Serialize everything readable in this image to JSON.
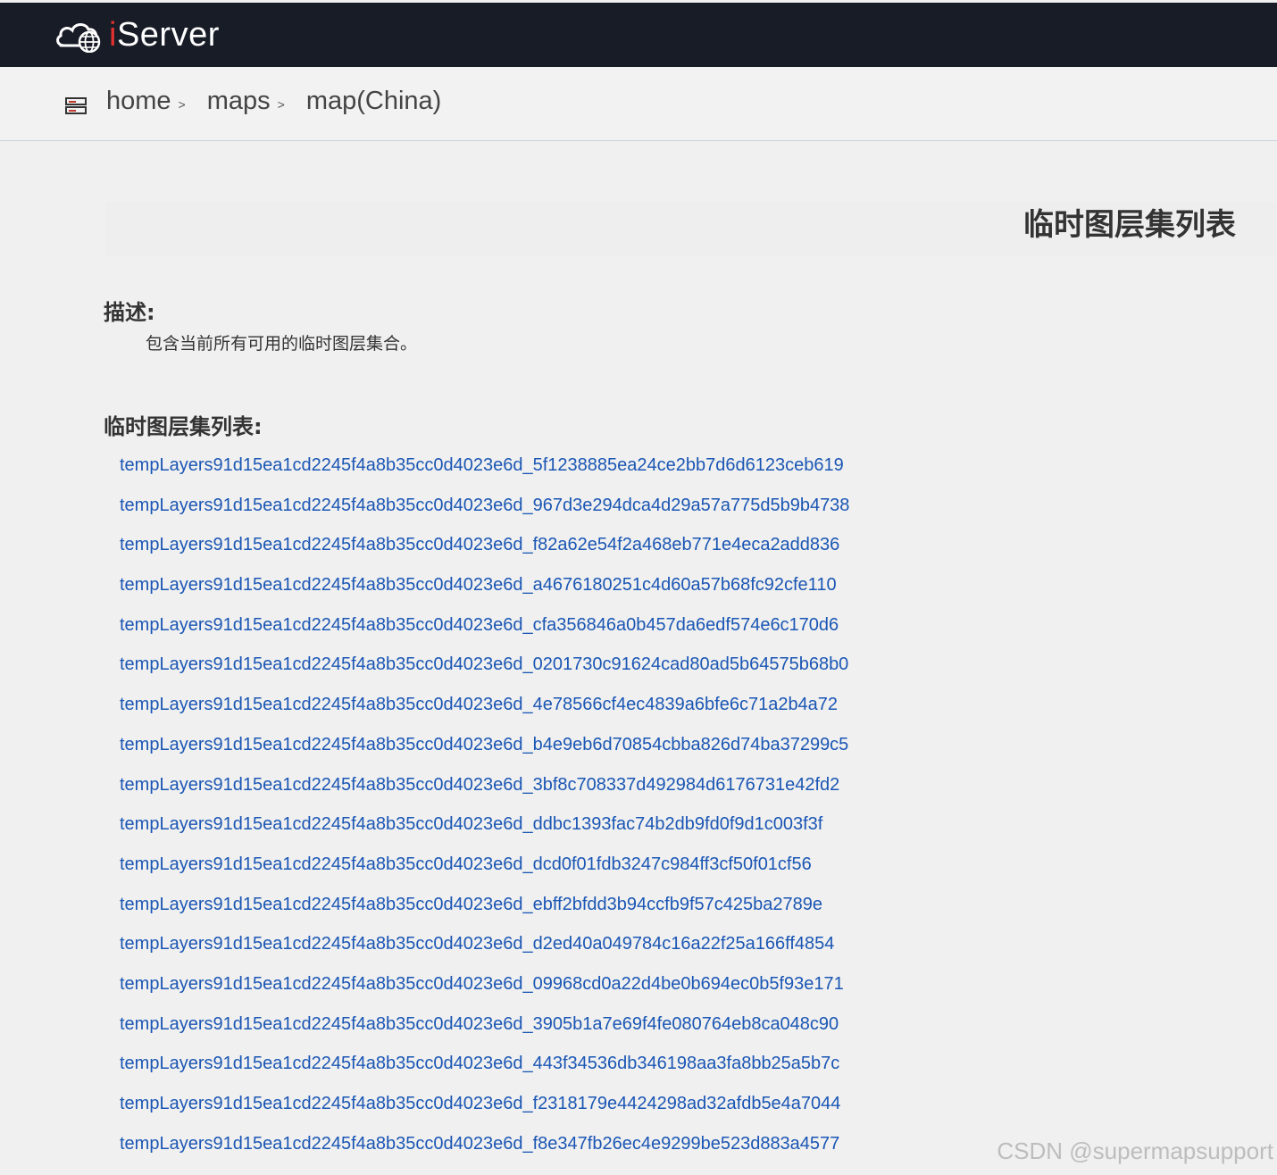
{
  "header": {
    "logo_text": "Server",
    "logo_i": "i",
    "logo_icon": "cloud-globe-icon",
    "accent": "#e0312f",
    "background": "#181c27"
  },
  "breadcrumb": {
    "icon": "server-stack-icon",
    "items": [
      {
        "label": "home",
        "sep": ">"
      },
      {
        "label": "maps",
        "sep": ">"
      },
      {
        "label": "map(China)"
      }
    ]
  },
  "page_title": "临时图层集列表",
  "description": {
    "heading": "描述:",
    "text": "包含当前所有可用的临时图层集合。"
  },
  "list": {
    "heading": "临时图层集列表:",
    "link_color": "#1a56b4",
    "items": [
      "tempLayers91d15ea1cd2245f4a8b35cc0d4023e6d_5f1238885ea24ce2bb7d6d6123ceb619",
      "tempLayers91d15ea1cd2245f4a8b35cc0d4023e6d_967d3e294dca4d29a57a775d5b9b4738",
      "tempLayers91d15ea1cd2245f4a8b35cc0d4023e6d_f82a62e54f2a468eb771e4eca2add836",
      "tempLayers91d15ea1cd2245f4a8b35cc0d4023e6d_a4676180251c4d60a57b68fc92cfe110",
      "tempLayers91d15ea1cd2245f4a8b35cc0d4023e6d_cfa356846a0b457da6edf574e6c170d6",
      "tempLayers91d15ea1cd2245f4a8b35cc0d4023e6d_0201730c91624cad80ad5b64575b68b0",
      "tempLayers91d15ea1cd2245f4a8b35cc0d4023e6d_4e78566cf4ec4839a6bfe6c71a2b4a72",
      "tempLayers91d15ea1cd2245f4a8b35cc0d4023e6d_b4e9eb6d70854cbba826d74ba37299c5",
      "tempLayers91d15ea1cd2245f4a8b35cc0d4023e6d_3bf8c708337d492984d6176731e42fd2",
      "tempLayers91d15ea1cd2245f4a8b35cc0d4023e6d_ddbc1393fac74b2db9fd0f9d1c003f3f",
      "tempLayers91d15ea1cd2245f4a8b35cc0d4023e6d_dcd0f01fdb3247c984ff3cf50f01cf56",
      "tempLayers91d15ea1cd2245f4a8b35cc0d4023e6d_ebff2bfdd3b94ccfb9f57c425ba2789e",
      "tempLayers91d15ea1cd2245f4a8b35cc0d4023e6d_d2ed40a049784c16a22f25a166ff4854",
      "tempLayers91d15ea1cd2245f4a8b35cc0d4023e6d_09968cd0a22d4be0b694ec0b5f93e171",
      "tempLayers91d15ea1cd2245f4a8b35cc0d4023e6d_3905b1a7e69f4fe080764eb8ca048c90",
      "tempLayers91d15ea1cd2245f4a8b35cc0d4023e6d_443f34536db346198aa3fa8bb25a5b7c",
      "tempLayers91d15ea1cd2245f4a8b35cc0d4023e6d_f2318179e4424298ad32afdb5e4a7044",
      "tempLayers91d15ea1cd2245f4a8b35cc0d4023e6d_f8e347fb26ec4e9299be523d883a4577"
    ]
  },
  "watermark": "CSDN @supermapsupport"
}
